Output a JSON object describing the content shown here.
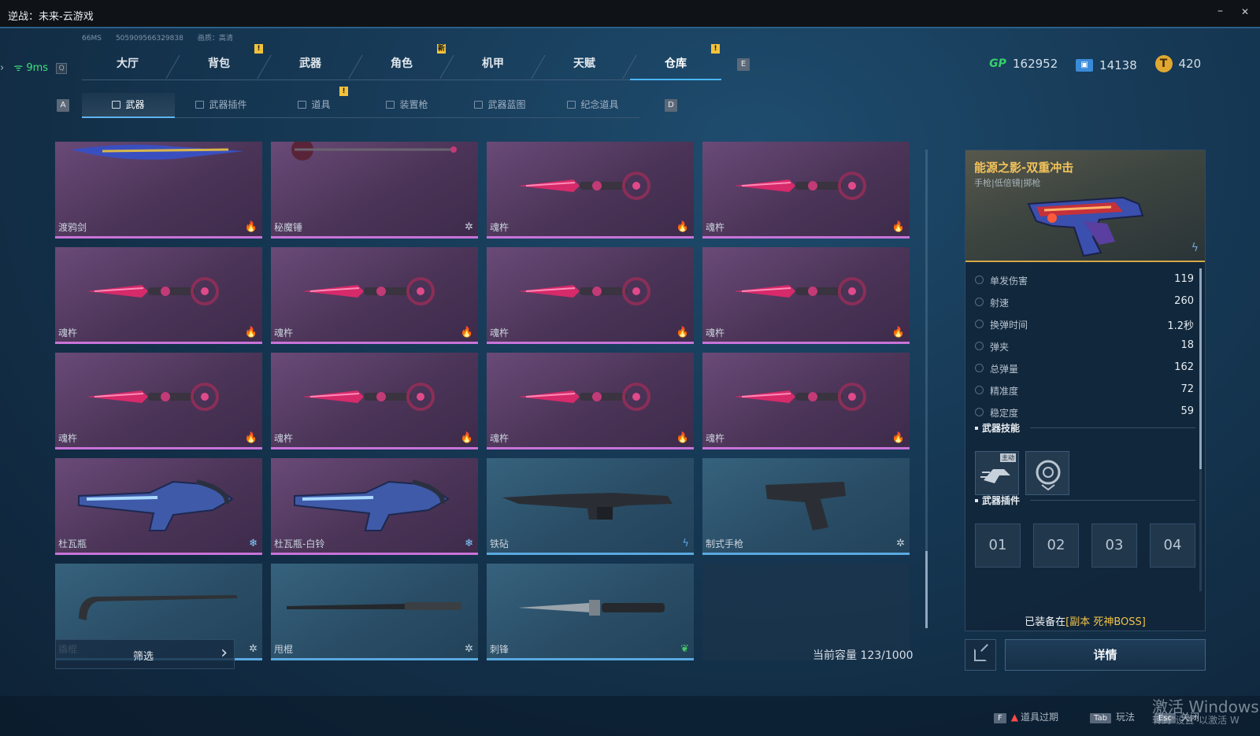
{
  "window": {
    "title": "逆战：未来-云游戏",
    "minimize": "–",
    "close": "✕"
  },
  "status": {
    "ms": "66MS",
    "id": "505909566329838",
    "quality": "画质：高清",
    "ping": "9ms",
    "ping_key": "Q"
  },
  "main_tabs": [
    {
      "label": "大厅"
    },
    {
      "label": "背包",
      "badge": "!"
    },
    {
      "label": "武器"
    },
    {
      "label": "角色",
      "badge": "新"
    },
    {
      "label": "机甲"
    },
    {
      "label": "天赋"
    },
    {
      "label": "仓库",
      "badge": "!",
      "active": true
    }
  ],
  "main_tabs_key_right": "E",
  "currency": [
    {
      "icon": "gp-icon",
      "symbol": "GP",
      "value": "162952"
    },
    {
      "icon": "ticket-icon",
      "value": "14138"
    },
    {
      "icon": "coin-icon",
      "value": "420"
    }
  ],
  "sub_tabs_key_left": "A",
  "sub_tabs_key_right": "D",
  "sub_tabs": [
    {
      "label": "武器",
      "active": true
    },
    {
      "label": "武器插件"
    },
    {
      "label": "道具",
      "badge": "!"
    },
    {
      "label": "装置枪"
    },
    {
      "label": "武器蓝图"
    },
    {
      "label": "纪念道具"
    }
  ],
  "items": [
    {
      "name": "渡鸦剑",
      "rarity": "purple",
      "element": "fire",
      "weapon": "sword"
    },
    {
      "name": "秘魔锤",
      "rarity": "purple",
      "element": "snow",
      "weapon": "hammer"
    },
    {
      "name": "魂杵",
      "rarity": "purple",
      "element": "fire",
      "weapon": "dagger"
    },
    {
      "name": "魂杵",
      "rarity": "purple",
      "element": "fire",
      "weapon": "dagger"
    },
    {
      "name": "魂杵",
      "rarity": "purple",
      "element": "fire",
      "weapon": "dagger"
    },
    {
      "name": "魂杵",
      "rarity": "purple",
      "element": "fire",
      "weapon": "dagger"
    },
    {
      "name": "魂杵",
      "rarity": "purple",
      "element": "fire",
      "weapon": "dagger"
    },
    {
      "name": "魂杵",
      "rarity": "purple",
      "element": "fire",
      "weapon": "dagger"
    },
    {
      "name": "魂杵",
      "rarity": "purple",
      "element": "fire",
      "weapon": "dagger"
    },
    {
      "name": "魂杵",
      "rarity": "purple",
      "element": "fire",
      "weapon": "dagger"
    },
    {
      "name": "魂杵",
      "rarity": "purple",
      "element": "fire",
      "weapon": "dagger"
    },
    {
      "name": "魂杵",
      "rarity": "purple",
      "element": "fire",
      "weapon": "dagger"
    },
    {
      "name": "杜瓦瓶",
      "rarity": "purple",
      "element": "ice",
      "weapon": "cannon"
    },
    {
      "name": "杜瓦瓶-白铃",
      "rarity": "purple",
      "element": "ice",
      "weapon": "cannon"
    },
    {
      "name": "铁砧",
      "rarity": "blue",
      "element": "bolt",
      "weapon": "rifle"
    },
    {
      "name": "制式手枪",
      "rarity": "blue",
      "element": "snow",
      "weapon": "pistol"
    },
    {
      "name": "撬棍",
      "rarity": "blue",
      "element": "snow",
      "weapon": "crowbar"
    },
    {
      "name": "甩棍",
      "rarity": "blue",
      "element": "snow",
      "weapon": "baton"
    },
    {
      "name": "刺锋",
      "rarity": "blue",
      "element": "leaf",
      "weapon": "knife"
    },
    {
      "name": "",
      "rarity": "empty",
      "element": "",
      "weapon": ""
    }
  ],
  "filter": {
    "label": "筛选"
  },
  "capacity": "当前容量 123/1000",
  "detail": {
    "name": "能源之影-双重冲击",
    "type": "手枪|低倍镜|掷枪",
    "stats": [
      {
        "label": "单发伤害",
        "value": "119"
      },
      {
        "label": "射速",
        "value": "260"
      },
      {
        "label": "换弹时间",
        "value": "1.2秒"
      },
      {
        "label": "弹夹",
        "value": "18"
      },
      {
        "label": "总弹量",
        "value": "162"
      },
      {
        "label": "精准度",
        "value": "72"
      },
      {
        "label": "稳定度",
        "value": "59"
      }
    ],
    "skills_title": "武器技能",
    "skill_tag": "主动",
    "plugins_title": "武器插件",
    "slots": [
      "01",
      "02",
      "03",
      "04"
    ],
    "equipped_prefix": "已装备在",
    "equipped_location": "[副本 死神BOSS]",
    "details_button": "详情"
  },
  "footer": [
    {
      "key": "F",
      "label": "道具过期",
      "warn": true
    },
    {
      "key": "Tab",
      "label": "玩法"
    },
    {
      "key": "Esc",
      "label": "关闭"
    }
  ],
  "watermark": {
    "line1": "激活 Windows",
    "line2": "转到\"设置\"以激活 W"
  }
}
